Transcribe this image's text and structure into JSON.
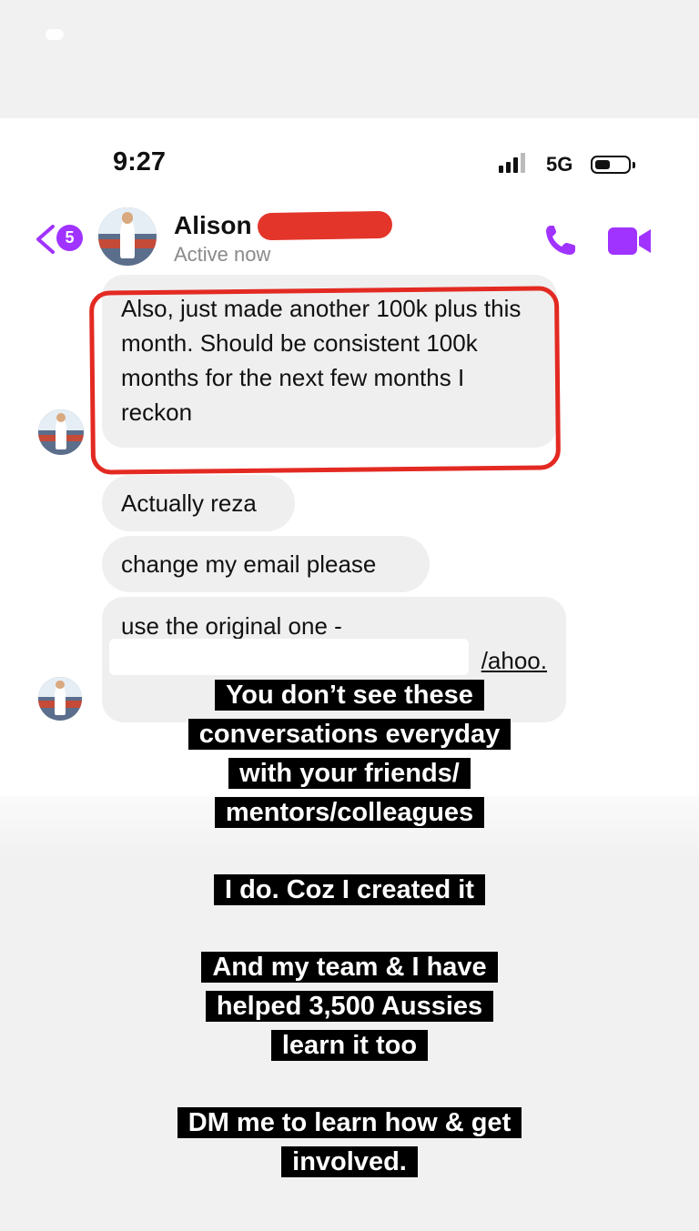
{
  "status_bar": {
    "time": "9:27",
    "network": "5G"
  },
  "header": {
    "back_count": "5",
    "contact_name": "Alison",
    "presence": "Active now",
    "accent_color": "#a033ff"
  },
  "messages": [
    {
      "text": "Also, just made another 100k plus this month. Should be consistent 100k months for the next few months I reckon",
      "highlighted": true
    },
    {
      "text": "Actually reza"
    },
    {
      "text": "change my email please"
    },
    {
      "text_line1": "use the original one -",
      "text_tail": "/ahoo."
    }
  ],
  "captions": [
    {
      "lines": [
        "You don’t see these",
        "conversations everyday",
        "with your friends/",
        "mentors/colleagues"
      ]
    },
    {
      "lines": [
        "I do. Coz I created it"
      ]
    },
    {
      "lines": [
        "And my team & I have",
        "helped 3,500 Aussies",
        "learn it too"
      ]
    },
    {
      "lines": [
        "DM me to learn how & get",
        "involved."
      ]
    }
  ],
  "icons": [
    "back-chevron-icon",
    "phone-icon",
    "video-camera-icon"
  ]
}
